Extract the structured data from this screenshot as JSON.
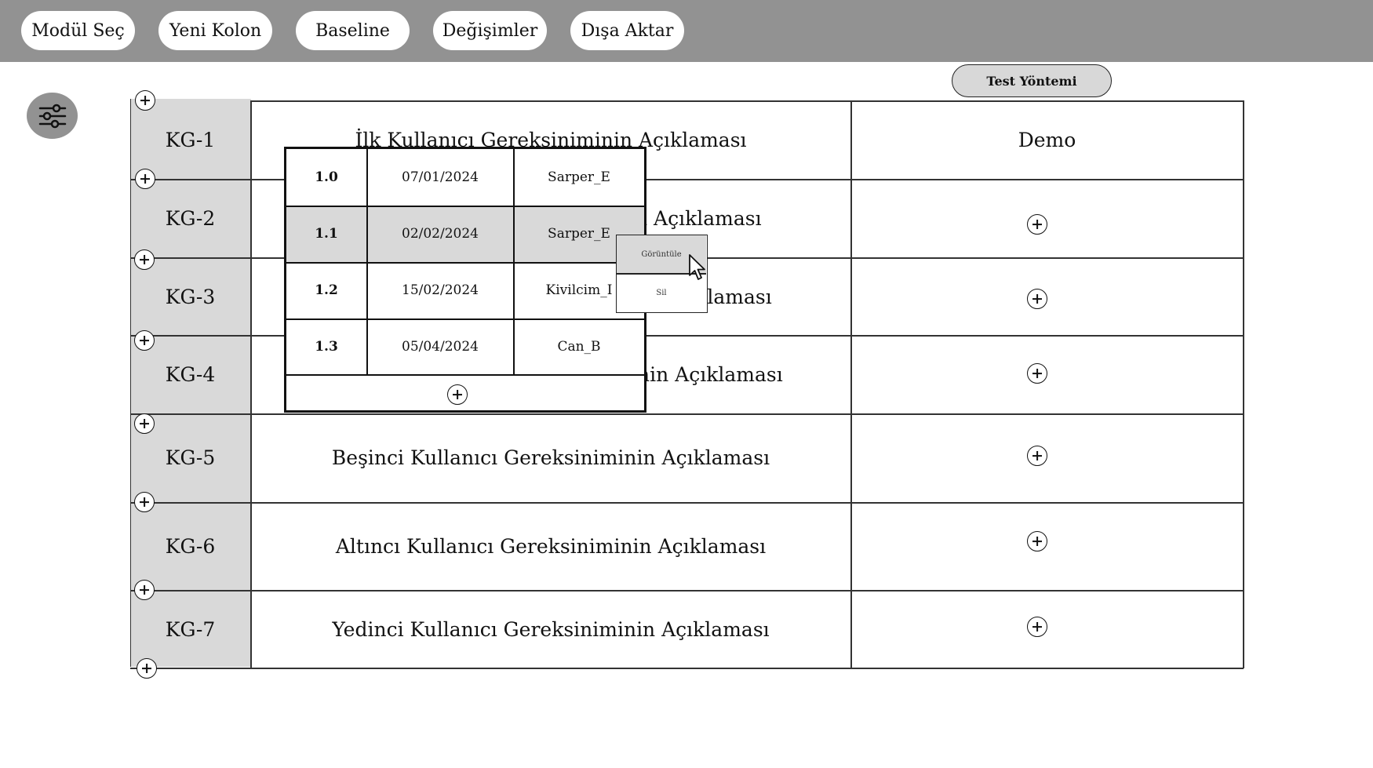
{
  "toolbar": {
    "buttons": [
      "Modül Seç",
      "Yeni Kolon",
      "Baseline",
      "Değişimler",
      "Dışa Aktar"
    ]
  },
  "filter_icon": "sliders-icon",
  "column_header": {
    "test_method": "Test Yöntemi"
  },
  "table": {
    "demo_label": "Demo",
    "rows": [
      {
        "id": "KG-1",
        "desc": "İlk Kullanıcı Gereksiniminin Açıklaması"
      },
      {
        "id": "KG-2",
        "desc": "İkinci Kullanıcı Gereksiniminin Açıklaması"
      },
      {
        "id": "KG-3",
        "desc": "Üçüncü Kullanıcı Gereksiniminin Açıklaması"
      },
      {
        "id": "KG-4",
        "desc": "Dördüncü Kullanıcı Gereksiniminin Açıklaması"
      },
      {
        "id": "KG-5",
        "desc": "Beşinci Kullanıcı Gereksiniminin Açıklaması"
      },
      {
        "id": "KG-6",
        "desc": "Altıncı Kullanıcı Gereksiniminin Açıklaması"
      },
      {
        "id": "KG-7",
        "desc": "Yedinci Kullanıcı Gereksiniminin Açıklaması"
      }
    ]
  },
  "version_popup": {
    "rows": [
      {
        "version": "1.0",
        "date": "07/01/2024",
        "user": "Sarper_E"
      },
      {
        "version": "1.1",
        "date": "02/02/2024",
        "user": "Sarper_E",
        "selected": true
      },
      {
        "version": "1.2",
        "date": "15/02/2024",
        "user": "Kivilcim_I"
      },
      {
        "version": "1.3",
        "date": "05/04/2024",
        "user": "Can_B"
      }
    ]
  },
  "context_menu": {
    "view": "Görüntüle",
    "delete": "Sil"
  },
  "colors": {
    "toolbar_bg": "#929292",
    "id_column_bg": "#d9d9d9",
    "selected_row_bg": "#d9d9d9"
  }
}
